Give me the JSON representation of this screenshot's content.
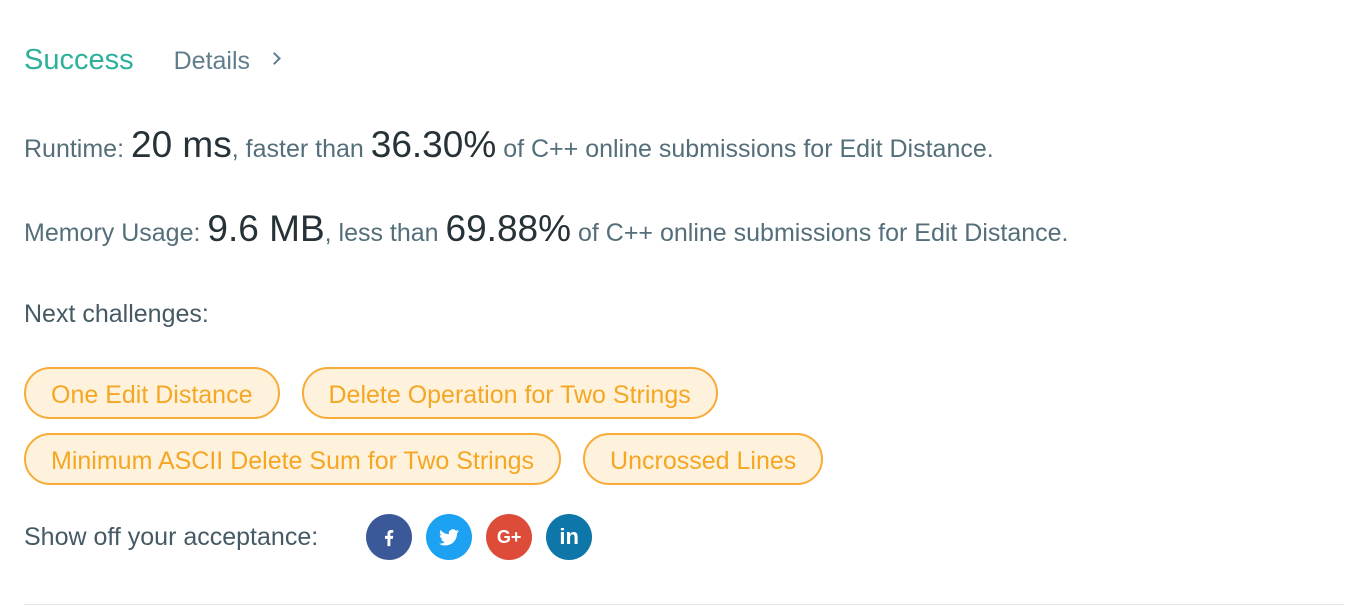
{
  "header": {
    "status": "Success",
    "details_label": "Details"
  },
  "runtime": {
    "label": "Runtime:",
    "value": "20 ms",
    "comparison": ", faster than",
    "percent": "36.30%",
    "suffix": "of C++ online submissions for Edit Distance."
  },
  "memory": {
    "label": "Memory Usage:",
    "value": "9.6 MB",
    "comparison": ", less than",
    "percent": "69.88%",
    "suffix": "of C++ online submissions for Edit Distance."
  },
  "next_challenges": {
    "label": "Next challenges:",
    "items": [
      "One Edit Distance",
      "Delete Operation for Two Strings",
      "Minimum ASCII Delete Sum for Two Strings",
      "Uncrossed Lines"
    ]
  },
  "share": {
    "label": "Show off your acceptance:",
    "icons": [
      {
        "name": "facebook-icon",
        "glyph": "f",
        "color": "#3b5998"
      },
      {
        "name": "twitter-icon",
        "glyph": "t",
        "color": "#1da1f2"
      },
      {
        "name": "google-plus-icon",
        "glyph": "G+",
        "color": "#dd4b39"
      },
      {
        "name": "linkedin-icon",
        "glyph": "in",
        "color": "#0e76a8"
      }
    ]
  },
  "colors": {
    "success": "#2db09c",
    "tag_border": "#f8ab37",
    "tag_bg": "#fef2dd",
    "tag_text": "#f5a623"
  }
}
